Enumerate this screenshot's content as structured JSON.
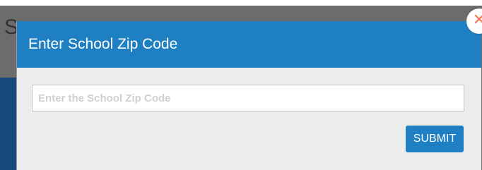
{
  "background": {
    "partial_heading_glyph": "S"
  },
  "modal": {
    "title": "Enter School Zip Code",
    "zip_input": {
      "value": "",
      "placeholder": "Enter the School Zip Code"
    },
    "submit_label": "SUBMIT",
    "close": {
      "icon": "close-icon",
      "glyph": "✕"
    }
  },
  "colors": {
    "header": "#1f7fc3",
    "button": "#1f7fc3",
    "close_icon": "#f07a4f",
    "modal_body": "#ececec"
  }
}
